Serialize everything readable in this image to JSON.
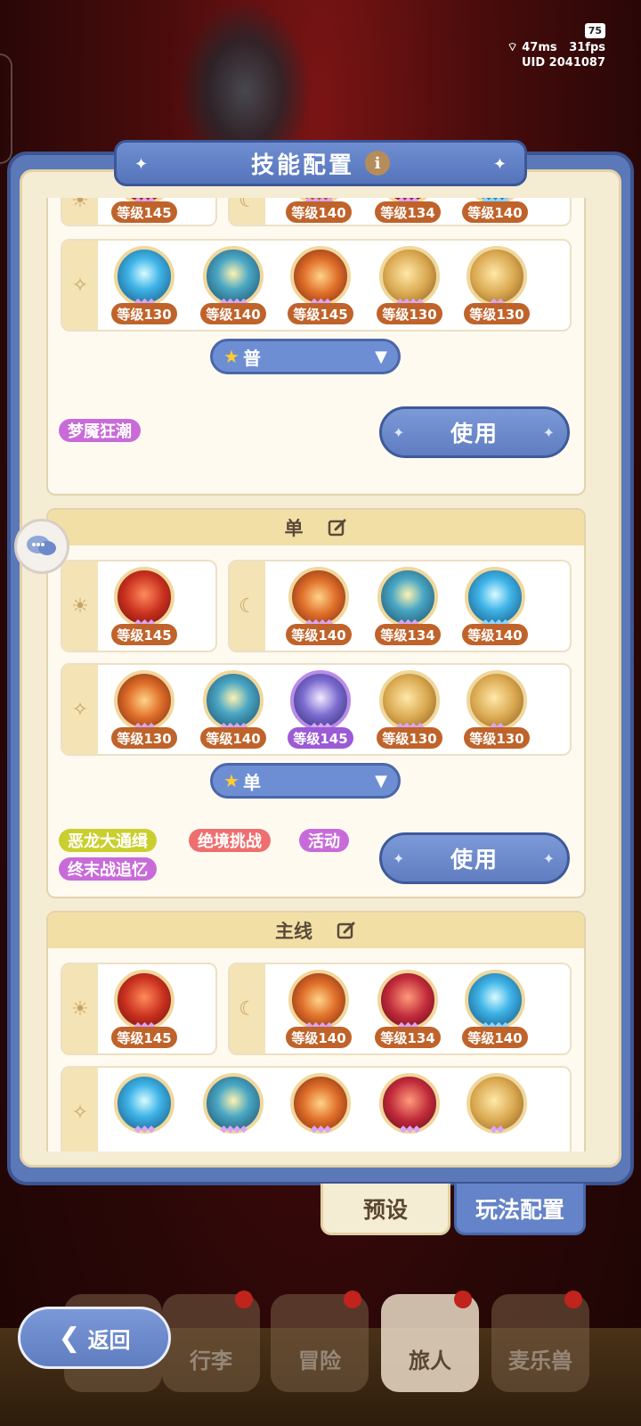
{
  "status": {
    "battery": "75",
    "ping": "47ms",
    "fps": "31fps",
    "uid": "UID 2041087"
  },
  "panel": {
    "title": "技能配置"
  },
  "preset1": {
    "sun_row": [
      "等级145"
    ],
    "moon_row": [
      "等级140",
      "等级134",
      "等级140"
    ],
    "star_row": [
      "等级130",
      "等级140",
      "等级145",
      "等级130",
      "等级130"
    ],
    "dropdown": "普",
    "tags": [
      "梦魇狂潮"
    ],
    "use_label": "使用"
  },
  "preset2": {
    "name": "单",
    "sun_row": [
      "等级145"
    ],
    "moon_row": [
      "等级140",
      "等级134",
      "等级140"
    ],
    "star_row": [
      "等级130",
      "等级140",
      "等级145",
      "等级130",
      "等级130"
    ],
    "dropdown": "单",
    "tags": [
      "恶龙大通缉",
      "绝境挑战",
      "活动",
      "终末战追忆"
    ],
    "use_label": "使用"
  },
  "preset3": {
    "name": "主线",
    "sun_row": [
      "等级145"
    ],
    "moon_row": [
      "等级140",
      "等级134",
      "等级140"
    ]
  },
  "tabs": {
    "preset": "预设",
    "gameplay": "玩法配置"
  },
  "nav": {
    "back": "返回",
    "items": [
      "行李",
      "冒险",
      "旅人",
      "麦乐兽"
    ]
  },
  "colors": {
    "tag_yellow": "#c9cf2e",
    "tag_red": "#ee6f6f",
    "tag_purple": "#c86bd9",
    "accent_blue": "#5f7dc0"
  }
}
